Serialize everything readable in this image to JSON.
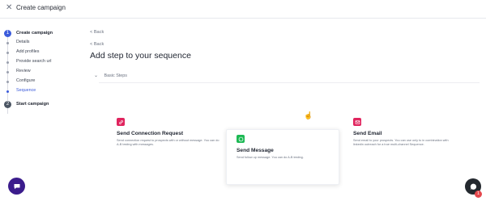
{
  "header": {
    "close_icon": "close-icon",
    "title": "Create campaign"
  },
  "sidebar": {
    "steps": [
      {
        "number": "1",
        "title": "Create campaign",
        "state": "active"
      },
      {
        "number": "2",
        "title": "Start campaign",
        "state": "inactive"
      }
    ],
    "substeps": [
      {
        "label": "Details"
      },
      {
        "label": "Add profiles"
      },
      {
        "label": "Provide search url"
      },
      {
        "label": "Review"
      },
      {
        "label": "Configure"
      },
      {
        "label": "Sequence",
        "active": true
      }
    ]
  },
  "main": {
    "back_top": "< Back",
    "back_second": "< Back",
    "title": "Add step to your sequence",
    "accordion_label": "Basic Steps"
  },
  "cards": [
    {
      "title": "Send Connection Request",
      "description": "Send connection request to prospects with or without message. You can do A-B testing with messages.",
      "icon": "link-icon",
      "icon_color": "#e0245e"
    },
    {
      "title": "Send Message",
      "description": "Send follow up message. You can do A-B testing.",
      "icon": "message-icon",
      "icon_color": "#1db954"
    },
    {
      "title": "Send Email",
      "description": "Send email to your prospects. You can use only to in combination with linkedin outreach for a true multi-channel Sequence.",
      "icon": "email-icon",
      "icon_color": "#e0245e"
    }
  ],
  "chat": {
    "badge_count": "1"
  },
  "colors": {
    "accent": "#3b5bdb",
    "chat_left": "#3b1c8c",
    "chat_right": "#24292f",
    "badge": "#e5484d"
  }
}
